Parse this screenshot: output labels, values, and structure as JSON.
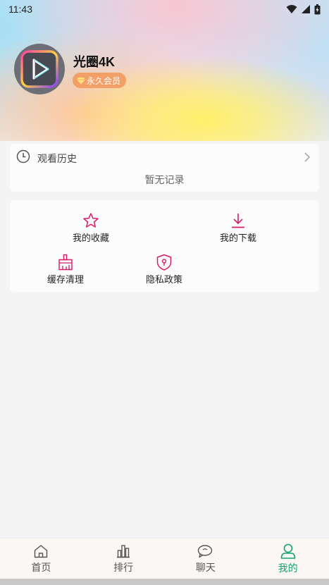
{
  "status_bar": {
    "time": "11:43",
    "icons": [
      "wifi-icon",
      "signal-icon",
      "battery-icon"
    ]
  },
  "profile": {
    "name": "光圈4K",
    "vip_label": "永久会员",
    "vip_color": "#f2a067"
  },
  "history": {
    "title": "观看历史",
    "empty_text": "暂无记录"
  },
  "menu": {
    "items": [
      {
        "label": "我的收藏",
        "icon": "star-icon"
      },
      {
        "label": "我的下载",
        "icon": "download-icon"
      },
      {
        "label": "缓存清理",
        "icon": "broom-icon"
      },
      {
        "label": "隐私政策",
        "icon": "shield-icon"
      }
    ],
    "icon_color": "#d81b6a"
  },
  "bottom_nav": {
    "items": [
      {
        "label": "首页",
        "icon": "home-icon"
      },
      {
        "label": "排行",
        "icon": "chart-icon"
      },
      {
        "label": "聊天",
        "icon": "chat-icon"
      },
      {
        "label": "我的",
        "icon": "user-icon",
        "active": true
      }
    ],
    "active_color": "#12a36c"
  }
}
